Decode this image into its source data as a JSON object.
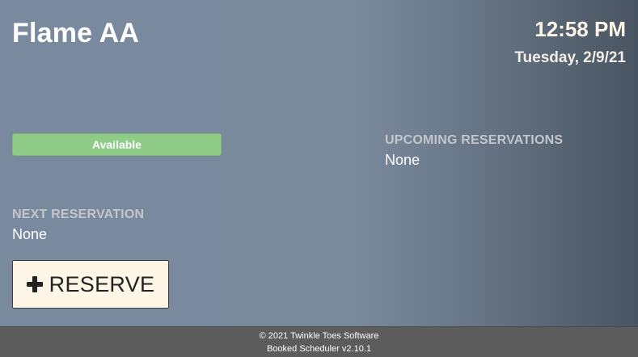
{
  "room": {
    "name": "Flame AA"
  },
  "clock": {
    "time": "12:58 PM",
    "date": "Tuesday, 2/9/21"
  },
  "status": {
    "label": "Available",
    "color": "#8dcb87"
  },
  "next_reservation": {
    "heading": "NEXT RESERVATION",
    "value": "None"
  },
  "upcoming_reservations": {
    "heading": "UPCOMING RESERVATIONS",
    "value": "None"
  },
  "reserve_button": {
    "icon": "plus-icon",
    "label": "RESERVE"
  },
  "footer": {
    "copyright": "© 2021 Twinkle Toes Software",
    "version": "Booked Scheduler v2.10.1"
  }
}
